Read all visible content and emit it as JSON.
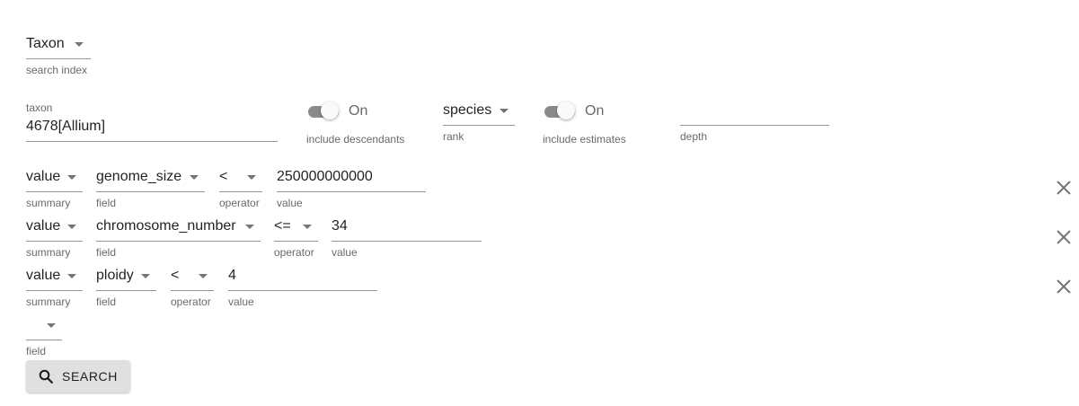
{
  "search_index": {
    "value": "Taxon",
    "helper": "search index"
  },
  "taxon": {
    "label": "taxon",
    "value": "4678[Allium]"
  },
  "include_descendants": {
    "state": "On",
    "helper": "include descendants"
  },
  "rank": {
    "value": "species",
    "helper": "rank"
  },
  "include_estimates": {
    "state": "On",
    "helper": "include estimates"
  },
  "depth": {
    "value": "",
    "helper": "depth"
  },
  "filter_helpers": {
    "summary": "summary",
    "field": "field",
    "operator": "operator",
    "value": "value"
  },
  "filters": [
    {
      "summary": "value",
      "field": "genome_size",
      "operator": "<",
      "value": "250000000000"
    },
    {
      "summary": "value",
      "field": "chromosome_number",
      "operator": "<=",
      "value": "34"
    },
    {
      "summary": "value",
      "field": "ploidy",
      "operator": "<",
      "value": "4"
    }
  ],
  "new_filter": {
    "field": "",
    "helper": "field"
  },
  "search_button": {
    "label": "SEARCH",
    "icon": "search-icon"
  },
  "icons": {
    "remove": "close-icon"
  }
}
